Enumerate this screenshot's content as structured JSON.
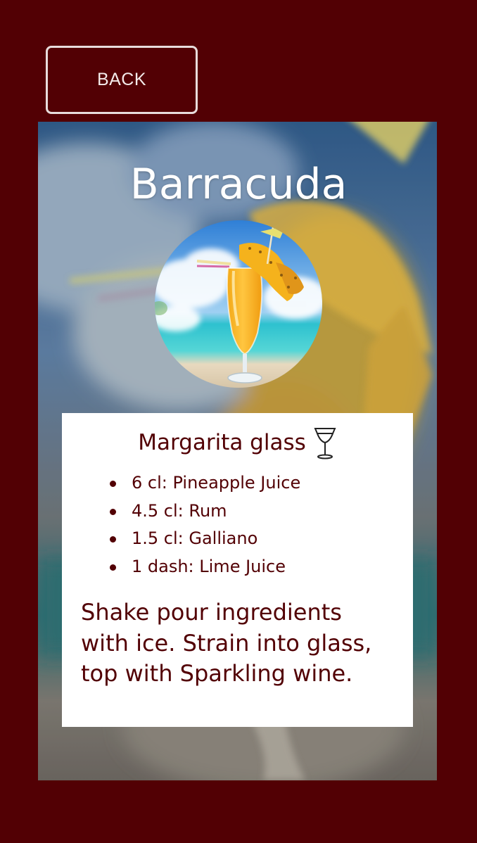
{
  "nav": {
    "back_label": "BACK"
  },
  "drink": {
    "name": "Barracuda",
    "glass": "Margarita glass",
    "glass_icon": "margarita-glass-icon",
    "ingredients": [
      {
        "text": "6 cl: Pineapple Juice"
      },
      {
        "text": "4.5 cl: Rum"
      },
      {
        "text": "1.5 cl: Galliano"
      },
      {
        "text": "1 dash: Lime Juice"
      }
    ],
    "instructions": "Shake pour ingredients with ice. Strain into glass, top with Sparkling wine."
  },
  "colors": {
    "background": "#520004",
    "text_dark": "#520004",
    "panel": "#ffffff",
    "title": "#ffffff"
  }
}
